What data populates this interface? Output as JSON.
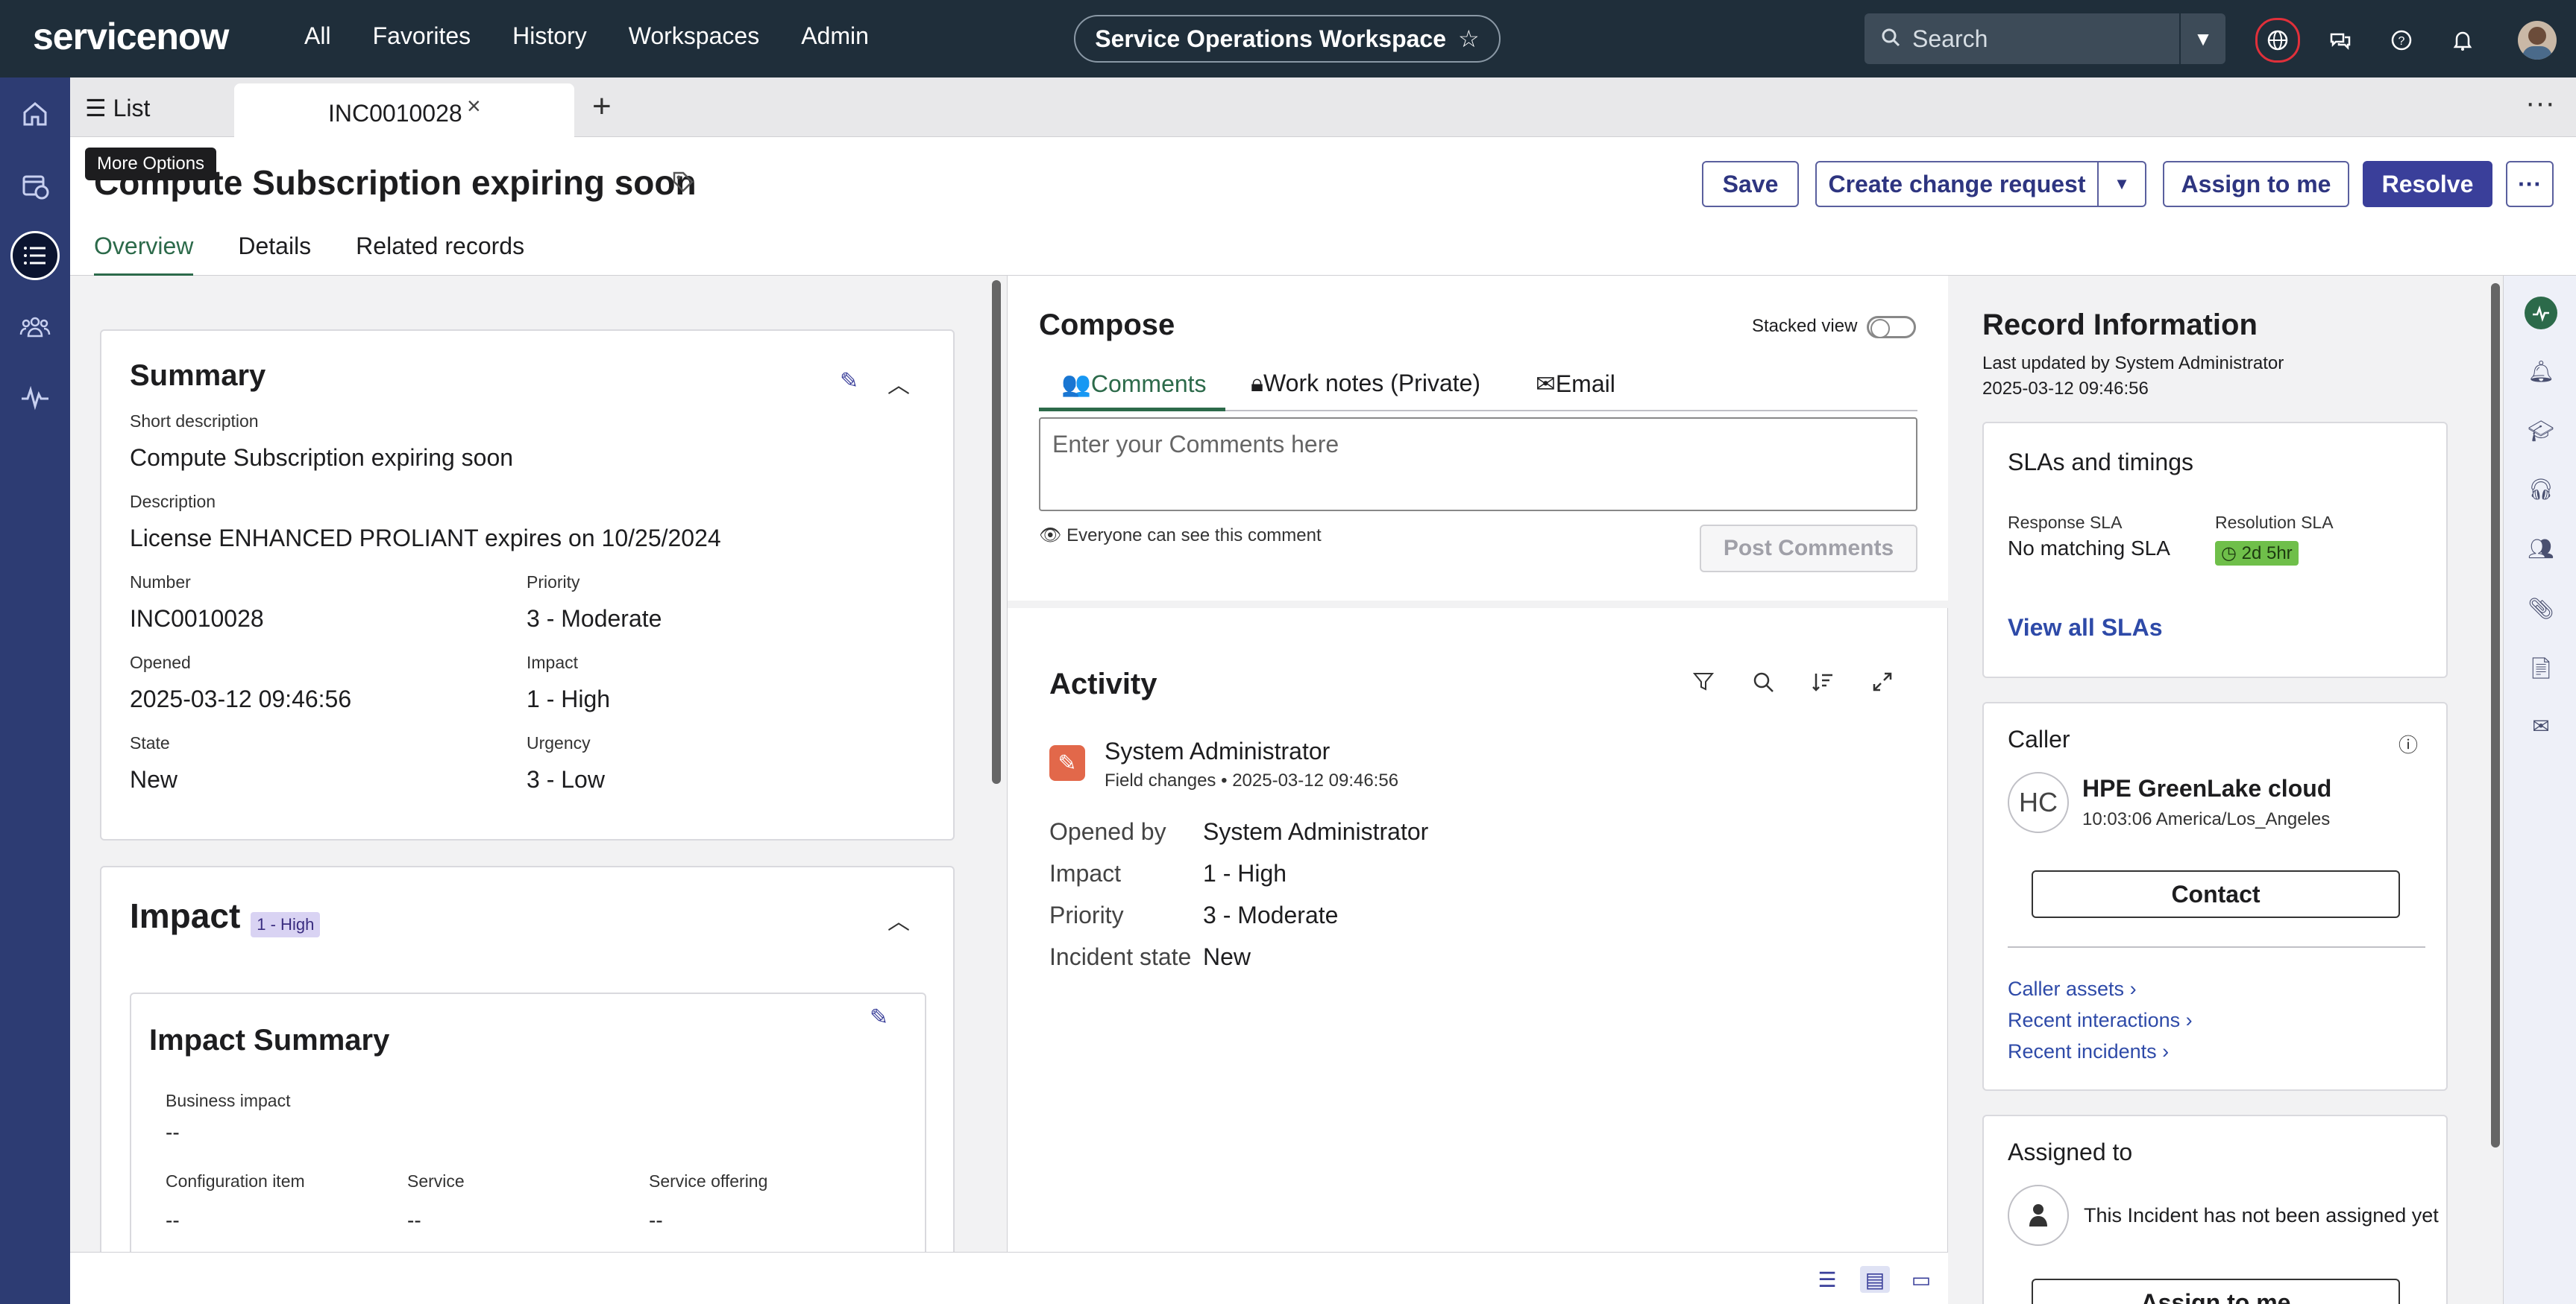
{
  "topnav": {
    "logo": "servicenow",
    "links": [
      "All",
      "Favorites",
      "History",
      "Workspaces",
      "Admin"
    ],
    "workspace": "Service Operations Workspace",
    "search_placeholder": "Search"
  },
  "tabs": {
    "list_label": "List",
    "incident_tab": "INC0010028",
    "tooltip": "More Options"
  },
  "header": {
    "title": "Compute Subscription expiring soon",
    "buttons": {
      "save": "Save",
      "create_change": "Create change request",
      "assign": "Assign to me",
      "resolve": "Resolve"
    },
    "subtabs": [
      "Overview",
      "Details",
      "Related records"
    ]
  },
  "summary": {
    "title": "Summary",
    "short_desc_label": "Short description",
    "short_desc": "Compute Subscription expiring soon",
    "desc_label": "Description",
    "desc": "License ENHANCED PROLIANT expires on 10/25/2024",
    "number_label": "Number",
    "number": "INC0010028",
    "priority_label": "Priority",
    "priority": "3 - Moderate",
    "opened_label": "Opened",
    "opened": "2025-03-12 09:46:56",
    "impact_label": "Impact",
    "impact": "1 - High",
    "state_label": "State",
    "state": "New",
    "urgency_label": "Urgency",
    "urgency": "3 - Low"
  },
  "impact": {
    "title": "Impact",
    "badge": "1 - High",
    "summary_title": "Impact Summary",
    "business_label": "Business impact",
    "business_val": "--",
    "ci_label": "Configuration item",
    "ci_val": "--",
    "service_label": "Service",
    "service_val": "--",
    "offering_label": "Service offering",
    "offering_val": "--"
  },
  "compose": {
    "title": "Compose",
    "stacked": "Stacked view",
    "tab_comments": "Comments",
    "tab_worknotes": "Work notes (Private)",
    "tab_email": "Email",
    "placeholder": "Enter your Comments here",
    "visibility": "Everyone can see this comment",
    "post": "Post Comments"
  },
  "activity": {
    "title": "Activity",
    "author": "System Administrator",
    "meta_type": "Field changes",
    "meta_time": "2025-03-12 09:46:56",
    "rows": [
      {
        "k": "Opened by",
        "v": "System Administrator"
      },
      {
        "k": "Impact",
        "v": "1 - High"
      },
      {
        "k": "Priority",
        "v": "3 - Moderate"
      },
      {
        "k": "Incident state",
        "v": "New"
      }
    ]
  },
  "record": {
    "title": "Record Information",
    "updated_by": "Last updated by System Administrator",
    "updated_at": "2025-03-12 09:46:56",
    "sla_title": "SLAs and timings",
    "response_label": "Response SLA",
    "response_val": "No matching SLA",
    "resolution_label": "Resolution SLA",
    "resolution_val": "2d 5hr",
    "view_slas": "View all SLAs",
    "caller_title": "Caller",
    "caller_initials": "HC",
    "caller_name": "HPE GreenLake cloud",
    "caller_time": "10:03:06 America/Los_Angeles",
    "contact": "Contact",
    "caller_assets": "Caller assets",
    "recent_interactions": "Recent interactions",
    "recent_incidents": "Recent incidents",
    "assigned_title": "Assigned to",
    "assigned_text": "This Incident has not been assigned yet",
    "assign_btn": "Assign to me"
  },
  "colors": {
    "nav_bg": "#1f2e3a",
    "rail_bg": "#2d3c73",
    "primary": "#3a3f9a",
    "accent_green": "#2c6a4a",
    "sla_green": "#6fbf4a"
  }
}
